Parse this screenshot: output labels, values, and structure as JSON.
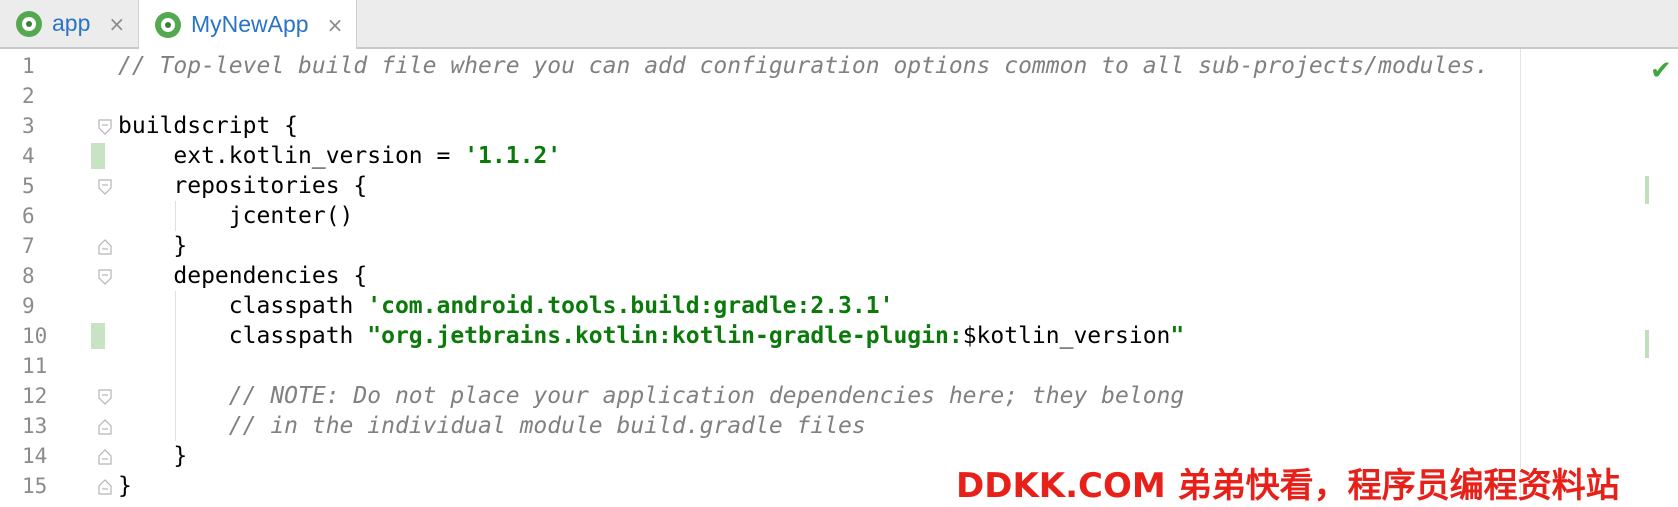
{
  "tabs": [
    {
      "label": "app",
      "active": false,
      "icon": "android-module-icon"
    },
    {
      "label": "MyNewApp",
      "active": true,
      "icon": "android-module-icon"
    }
  ],
  "close_glyph": "×",
  "editor": {
    "line_numbers": [
      "1",
      "2",
      "3",
      "4",
      "5",
      "6",
      "7",
      "8",
      "9",
      "10",
      "11",
      "12",
      "13",
      "14",
      "15"
    ],
    "lines": [
      {
        "segments": [
          {
            "t": "comment",
            "v": "// Top-level build file where you can add configuration options common to all sub-projects/modules."
          }
        ]
      },
      {
        "segments": []
      },
      {
        "segments": [
          {
            "t": "plain",
            "v": "buildscript {"
          }
        ]
      },
      {
        "segments": [
          {
            "t": "plain",
            "v": "    ext.kotlin_version = "
          },
          {
            "t": "string",
            "v": "'1.1.2'"
          }
        ]
      },
      {
        "segments": [
          {
            "t": "plain",
            "v": "    repositories {"
          }
        ]
      },
      {
        "segments": [
          {
            "t": "plain",
            "v": "        jcenter()"
          }
        ]
      },
      {
        "segments": [
          {
            "t": "plain",
            "v": "    }"
          }
        ]
      },
      {
        "segments": [
          {
            "t": "plain",
            "v": "    dependencies {"
          }
        ]
      },
      {
        "segments": [
          {
            "t": "plain",
            "v": "        classpath "
          },
          {
            "t": "string",
            "v": "'com.android.tools.build:gradle:2.3.1'"
          }
        ]
      },
      {
        "segments": [
          {
            "t": "plain",
            "v": "        classpath "
          },
          {
            "t": "string",
            "v": "\"org.jetbrains.kotlin:kotlin-gradle-plugin:"
          },
          {
            "t": "plain",
            "v": "$kotlin_version"
          },
          {
            "t": "string",
            "v": "\""
          }
        ]
      },
      {
        "segments": []
      },
      {
        "segments": [
          {
            "t": "plain",
            "v": "        "
          },
          {
            "t": "comment",
            "v": "// NOTE: Do not place your application dependencies here; they belong"
          }
        ]
      },
      {
        "segments": [
          {
            "t": "plain",
            "v": "        "
          },
          {
            "t": "comment",
            "v": "// in the individual module build.gradle files"
          }
        ]
      },
      {
        "segments": [
          {
            "t": "plain",
            "v": "    }"
          }
        ]
      },
      {
        "segments": [
          {
            "t": "plain",
            "v": "}"
          }
        ]
      }
    ]
  },
  "status": {
    "inspection_icon": "check-icon",
    "inspection_glyph": "✔"
  },
  "watermark": "DDKK.COM 弟弟快看，程序员编程资料站",
  "colors": {
    "string": "#0b7a0b",
    "comment": "#808080",
    "tab_text": "#2a74c7",
    "watermark": "#e8201a"
  }
}
